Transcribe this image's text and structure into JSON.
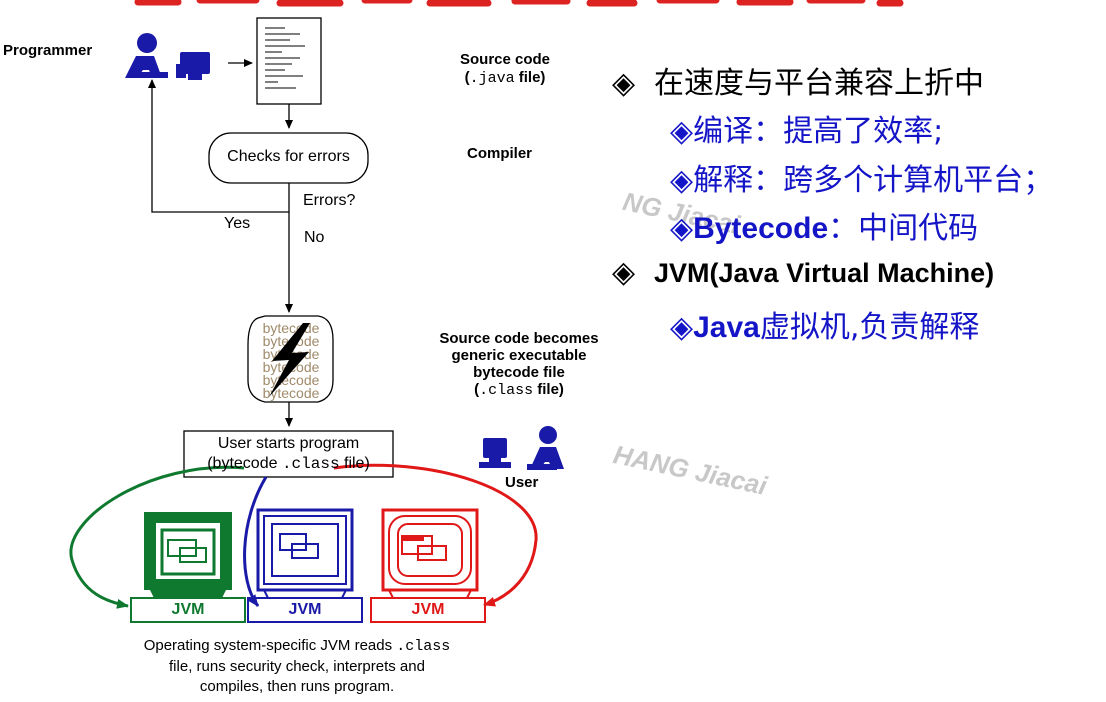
{
  "diagram": {
    "programmer_label": "Programmer",
    "source_code": {
      "line1": "Source code",
      "open": "(",
      "ext": ".java",
      "rest": " file)"
    },
    "checks_for_errors": "Checks for errors",
    "compiler_label": "Compiler",
    "errors_question": "Errors?",
    "yes_label": "Yes",
    "no_label": "No",
    "bytecode_word": "bytecode",
    "becomes": {
      "line1": "Source code becomes",
      "line2": "generic executable",
      "line3": "bytecode file",
      "open": "(",
      "ext": ".class",
      "rest": " file)"
    },
    "user_starts": {
      "line1": "User starts program",
      "open": "(bytecode ",
      "ext": ".class",
      "rest": " file)"
    },
    "user_label": "User",
    "jvm_labels": [
      "JVM",
      "JVM",
      "JVM"
    ],
    "machine_colors": [
      "#0f7a2f",
      "#1a1aa8",
      "#e01818"
    ],
    "caption": {
      "line1a": "Operating system-specific JVM reads ",
      "line1b": ".class",
      "line2": "file, runs security check, interprets and",
      "line3": "compiles, then runs program."
    }
  },
  "bullets": {
    "symbol": "◈",
    "main1": "在速度与平台兼容上折中",
    "sub1": "编译：提高了效率;",
    "sub2": "解释：跨多个计算机平台；",
    "sub3_bold": "Bytecode",
    "sub3_rest": "：中间代码",
    "main2": "JVM(Java Virtual Machine)",
    "sub4_bold": "Java",
    "sub4_rest": "虚拟机,负责解释"
  },
  "watermarks": [
    "NG Jiacai",
    "HANG Jiacai"
  ],
  "colors": {
    "bullet_sub": "#1515c8",
    "top_title": "#dd2222"
  }
}
